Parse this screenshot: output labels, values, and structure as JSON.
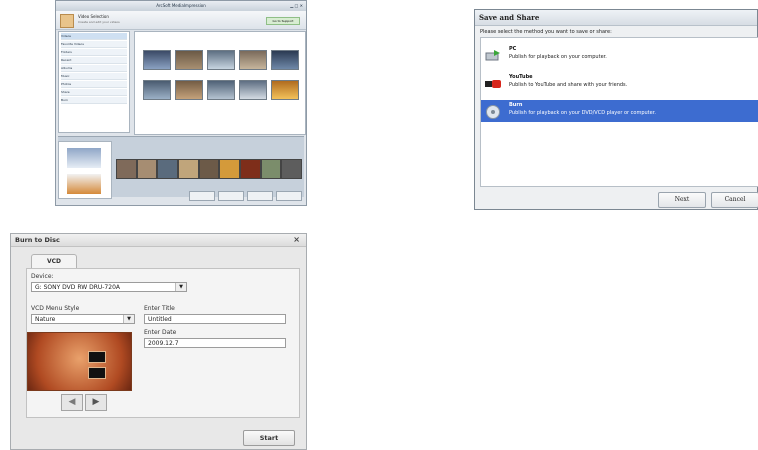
{
  "panel_main": {
    "title": "ArcSoft MediaImpression",
    "window_controls": "▁ □ ✕",
    "header_title": "Video Selection",
    "header_subtitle": "Create and edit your videos",
    "header_button": "Go to Support",
    "nav_items": [
      "Videos",
      "Favorite Videos",
      "Folders",
      "Recent",
      "Albums",
      "Music",
      "Photos",
      "Share",
      "Burn"
    ],
    "strip_colors": [
      "#7f6a5a",
      "#a68d72",
      "#5a6b7d",
      "#c0a57b",
      "#6c5a48",
      "#d49a3a",
      "#7e2e1a",
      "#7b8d6b",
      "#5d5d5d"
    ]
  },
  "panel_share": {
    "title": "Save and Share",
    "prompt": "Please select the method you want to save or share:",
    "options": [
      {
        "title": "PC",
        "desc": "Publish for playback on your computer."
      },
      {
        "title": "YouTube",
        "desc": "Publish to YouTube and share with your friends."
      },
      {
        "title": "Burn",
        "desc": "Publish for playback on your DVD/VCD player or computer."
      }
    ],
    "selected_index": 2,
    "next_label": "Next",
    "cancel_label": "Cancel"
  },
  "panel_burn": {
    "title": "Burn to Disc",
    "close": "×",
    "tab": "VCD",
    "device_label": "Device:",
    "device_value": "G: SONY DVD RW DRU-720A",
    "menu_style_label": "VCD Menu Style",
    "menu_style_value": "Nature",
    "enter_title_label": "Enter Title",
    "enter_title_value": "Untitled",
    "enter_date_label": "Enter Date",
    "enter_date_value": "2009.12.7",
    "prev_arrow": "◀",
    "next_arrow": "▶",
    "start_label": "Start"
  }
}
